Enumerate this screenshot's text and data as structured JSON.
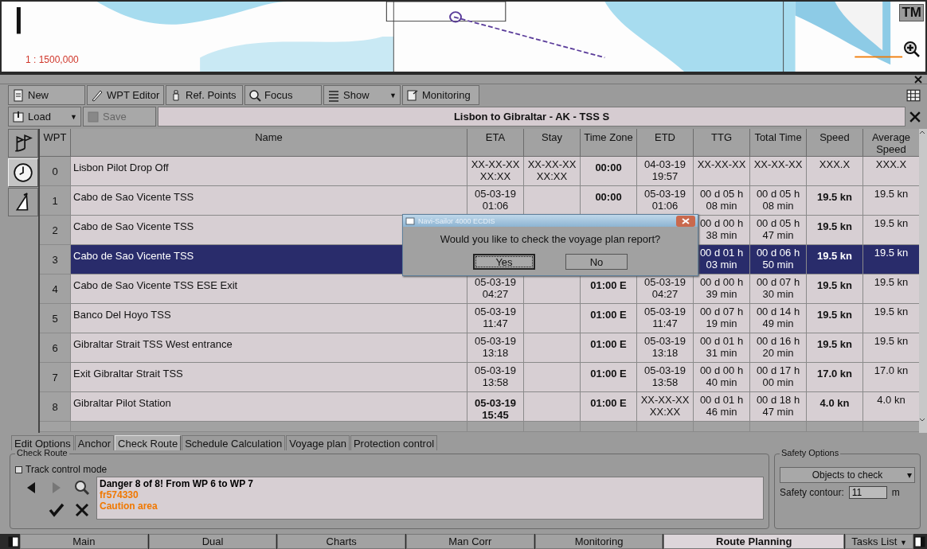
{
  "chart_view": {
    "scale": "1 : 1500,000",
    "mode_button": "TM"
  },
  "toolbar": {
    "row_1": [
      {
        "label": "New"
      },
      {
        "label": "WPT Editor"
      },
      {
        "label": "Ref. Points"
      },
      {
        "label": "Focus"
      },
      {
        "label": "Show",
        "arrow": "▼"
      },
      {
        "label": "Monitoring"
      }
    ],
    "row_2": [
      {
        "label": "Load",
        "arrow": "▼",
        "disabled": false
      },
      {
        "label": "Save",
        "disabled": true
      }
    ],
    "route_title": "Lisbon to Gibraltar - AK - TSS S"
  },
  "side_tools": [
    {
      "selected": false
    },
    {
      "selected": true
    },
    {
      "selected": false
    }
  ],
  "table": {
    "columns": [
      "WPT",
      "Name",
      "ETA",
      "Stay",
      "Time Zone",
      "ETD",
      "TTG",
      "Total Time",
      "Speed",
      "Average Speed"
    ],
    "rows": [
      {
        "wpt": "0",
        "name": "Lisbon Pilot Drop Off",
        "eta": "XX-XX-XX\nXX:XX",
        "stay": "XX-XX-XX\nXX:XX",
        "tz": "00:00",
        "etd": "04-03-19\n19:57",
        "ttg": "XX-XX-XX",
        "total": "XX-XX-XX",
        "speed": "XXX.X",
        "avg": "XXX.X",
        "selected": false,
        "kind": "start"
      },
      {
        "wpt": "1",
        "name": "Cabo de Sao Vicente TSS",
        "eta": "05-03-19\n01:06",
        "tz": "00:00",
        "etd": "05-03-19\n01:06",
        "ttg": "00 d 05 h\n08 min",
        "total": "00 d 05 h\n08 min",
        "speed": "19.5 kn",
        "avg": "19.5 kn",
        "selected": false,
        "kind": "leg"
      },
      {
        "wpt": "2",
        "name": "Cabo de Sao Vicente TSS",
        "ttg": "00 d 00 h\n38 min",
        "total": "00 d 05 h\n47 min",
        "speed": "19.5 kn",
        "avg": "19.5 kn",
        "selected": false,
        "kind": "leg"
      },
      {
        "wpt": "3",
        "name": "Cabo de Sao Vicente TSS",
        "ttg": "00 d 01 h\n03 min",
        "total": "00 d 06 h\n50 min",
        "speed": "19.5 kn",
        "avg": "19.5 kn",
        "selected": true,
        "kind": "leg"
      },
      {
        "wpt": "4",
        "name": "Cabo de Sao Vicente TSS ESE Exit",
        "eta": "05-03-19\n04:27",
        "tz": "01:00 E",
        "etd": "05-03-19\n04:27",
        "ttg": "00 d 00 h\n39 min",
        "total": "00 d 07 h\n30 min",
        "speed": "19.5 kn",
        "avg": "19.5 kn",
        "selected": false,
        "kind": "leg"
      },
      {
        "wpt": "5",
        "name": "Banco Del Hoyo TSS",
        "eta": "05-03-19\n11:47",
        "tz": "01:00 E",
        "etd": "05-03-19\n11:47",
        "ttg": "00 d 07 h\n19 min",
        "total": "00 d 14 h\n49 min",
        "speed": "19.5 kn",
        "avg": "19.5 kn",
        "selected": false,
        "kind": "leg"
      },
      {
        "wpt": "6",
        "name": "Gibraltar Strait TSS West entrance",
        "eta": "05-03-19\n13:18",
        "tz": "01:00 E",
        "etd": "05-03-19\n13:18",
        "ttg": "00 d 01 h\n31 min",
        "total": "00 d 16 h\n20 min",
        "speed": "19.5 kn",
        "avg": "19.5 kn",
        "selected": false,
        "kind": "leg"
      },
      {
        "wpt": "7",
        "name": "Exit Gibraltar Strait TSS",
        "eta": "05-03-19\n13:58",
        "tz": "01:00 E",
        "etd": "05-03-19\n13:58",
        "ttg": "00 d 00 h\n40 min",
        "total": "00 d 17 h\n00 min",
        "speed": "17.0 kn",
        "avg": "17.0 kn",
        "selected": false,
        "kind": "leg"
      },
      {
        "wpt": "8",
        "name": "Gibraltar Pilot Station",
        "eta": "05-03-19\n15:45",
        "tz": "01:00 E",
        "etd": "XX-XX-XX\nXX:XX",
        "ttg": "00 d 01 h\n46 min",
        "total": "00 d 18 h\n47 min",
        "speed": "4.0 kn",
        "avg": "4.0 kn",
        "selected": false,
        "kind": "end"
      }
    ]
  },
  "dialog": {
    "title": "Navi-Sailor 4000 ECDIS",
    "message": "Would you like to check the voyage plan report?",
    "buttons": [
      {
        "label": "Yes",
        "selected": true
      },
      {
        "label": "No",
        "selected": false
      }
    ]
  },
  "tabs": [
    {
      "label": "Edit Options",
      "selected": false
    },
    {
      "label": "Anchor",
      "selected": false
    },
    {
      "label": "Check Route",
      "selected": true
    },
    {
      "label": "Schedule Calculation",
      "selected": false
    },
    {
      "label": "Voyage plan",
      "selected": false
    },
    {
      "label": "Protection control",
      "selected": false
    }
  ],
  "check_route": {
    "title": "Check Route",
    "track_control": {
      "label": "Track control mode",
      "checked": false
    },
    "nav": [
      {
        "disabled": false
      },
      {
        "disabled": true
      },
      {
        "disabled": false
      },
      {
        "disabled": false
      },
      {
        "disabled": false
      }
    ],
    "message": [
      {
        "text": "Danger 8 of 8! From WP 6 to WP 7",
        "color": "#000000"
      },
      {
        "text": "fr574330",
        "color": "#f07800"
      },
      {
        "text": "Caution area",
        "color": "#f07800"
      }
    ]
  },
  "safety_options": {
    "title": "Safety Options",
    "objects": "Objects to check",
    "objects_arrow": "▾",
    "contour_label": "Safety contour:",
    "contour_value": "11",
    "unit": "m"
  },
  "task_bar": {
    "items": [
      {
        "label": "Main",
        "selected": false
      },
      {
        "label": "Dual",
        "selected": false
      },
      {
        "label": "Charts",
        "selected": false
      },
      {
        "label": "Man Corr",
        "selected": false
      },
      {
        "label": "Monitoring",
        "selected": false
      },
      {
        "label": "Route Planning",
        "selected": true
      }
    ],
    "tasks_list": "Tasks List",
    "tasks_arrow": "▼"
  }
}
